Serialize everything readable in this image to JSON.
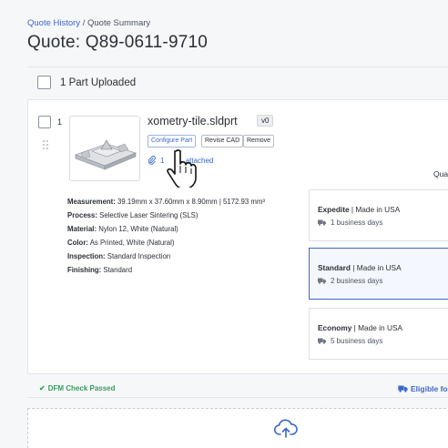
{
  "breadcrumb": {
    "home": "Quote History",
    "separator": " / ",
    "current": "Quote Summary"
  },
  "page": {
    "title": "Quote: Q89-0611-9710"
  },
  "parts_header": {
    "label": "1 Part Uploaded"
  },
  "part": {
    "index": "1",
    "file_name": "xometry-tile.sldprt",
    "version": "v0",
    "buttons": {
      "configure": "Configure Part",
      "revise": "Revise CAD",
      "remove": "Remove"
    },
    "attachments": {
      "count": "1",
      "text_visible": "attached"
    },
    "quantity_label": "Qua",
    "specs": [
      {
        "label": "Measurement:",
        "value": " 39.19mm x 37.60mm x 8.90mm | 5172.93 mm³"
      },
      {
        "label": "Process:",
        "value": " Selective Laser Sintering (SLS)"
      },
      {
        "label": "Material:",
        "value": " Nylon 12, White (Natural)"
      },
      {
        "label": "Color:",
        "value": " As Printed, White (Natural)"
      },
      {
        "label": "Inspection:",
        "value": " Standard Inspection"
      },
      {
        "label": "Finishing:",
        "value": " Standard"
      }
    ],
    "lead_time_options": [
      {
        "tier": "Expedite",
        "origin": " | Made in USA",
        "days": "1 business days",
        "selected": false
      },
      {
        "tier": "Standard",
        "origin": " | Made in USA",
        "days": "2 business days",
        "selected": true
      },
      {
        "tier": "Economy",
        "origin": " | Made in USA",
        "days": "5 business days",
        "selected": false
      }
    ],
    "dfm_status": "DFM Check Passed",
    "shipping_badge": "Eligible for"
  },
  "icons": {
    "upload": "cloud-upload-icon",
    "attachment": "paperclip-icon",
    "shipping": "truck-icon",
    "dfm": "check-icon",
    "cursor": "hand-pointer-icon"
  },
  "colors": {
    "accent": "#3b67c9",
    "success": "#3c9a5f",
    "border": "#e2e5ea"
  }
}
